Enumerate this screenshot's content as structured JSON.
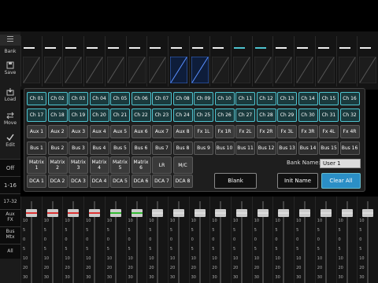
{
  "sidebar": {
    "items": [
      {
        "label": "Bank"
      },
      {
        "label": "Save"
      },
      {
        "label": "Load"
      },
      {
        "label": "Move"
      },
      {
        "label": "Edit"
      },
      {
        "label": "Off"
      },
      {
        "label": "1-16"
      },
      {
        "label": "17-32"
      },
      {
        "label": "Aux\nFX"
      },
      {
        "label": "Bus\nMtx"
      },
      {
        "label": "All"
      }
    ]
  },
  "grid": {
    "channels_row1": [
      "Ch 01",
      "Ch 02",
      "Ch 03",
      "Ch 04",
      "Ch 05",
      "Ch 06",
      "Ch 07",
      "Ch 08",
      "Ch 09",
      "Ch 10",
      "Ch 11",
      "Ch 12",
      "Ch 13",
      "Ch 14",
      "Ch 15",
      "Ch 16"
    ],
    "channels_row2": [
      "Ch 17",
      "Ch 18",
      "Ch 19",
      "Ch 20",
      "Ch 21",
      "Ch 22",
      "Ch 23",
      "Ch 24",
      "Ch 25",
      "Ch 26",
      "Ch 27",
      "Ch 28",
      "Ch 29",
      "Ch 30",
      "Ch 31",
      "Ch 32"
    ],
    "aux_row": [
      "Aux 1",
      "Aux 2",
      "Aux 3",
      "Aux 4",
      "Aux 5",
      "Aux 6",
      "Aux 7",
      "Aux 8",
      "Fx 1L",
      "Fx 1R",
      "Fx 2L",
      "Fx 2R",
      "Fx 3L",
      "Fx 3R",
      "Fx 4L",
      "Fx 4R"
    ],
    "bus_row": [
      "Bus 1",
      "Bus 2",
      "Bus 3",
      "Bus 4",
      "Bus 5",
      "Bus 6",
      "Bus 7",
      "Bus 8",
      "Bus 9",
      "Bus 10",
      "Bus 11",
      "Bus 12",
      "Bus 13",
      "Bus 14",
      "Bus 15",
      "Bus 16"
    ],
    "matrix_row": [
      "Matrix\n1",
      "Matrix\n2",
      "Matrix\n3",
      "Matrix\n4",
      "Matrix\n5",
      "Matrix\n6",
      "LR",
      "M/C"
    ],
    "dca_row": [
      "DCA 1",
      "DCA 2",
      "DCA 3",
      "DCA 4",
      "DCA 5",
      "DCA 6",
      "DCA 7",
      "DCA 8"
    ]
  },
  "actions": {
    "blank": "Blank",
    "init_name": "Init Name",
    "clear_all": "Clear All"
  },
  "bank_name": {
    "label": "Bank Name",
    "value": "User 1"
  },
  "faders": {
    "scale": [
      "10",
      "5",
      "0",
      "5",
      "10",
      "20",
      "30"
    ],
    "stripe_colors": [
      "#d33",
      "#d33",
      "#d33",
      "#d33",
      "#3b3",
      "#3b3",
      "#ddd",
      "#ddd",
      "#ddd",
      "#ddd",
      "#ddd",
      "#ddd",
      "#ddd",
      "#ddd",
      "#ddd",
      "#ddd",
      "#ddd"
    ]
  },
  "colors": {
    "channel_border": "#4ec3cf",
    "clear_all": "#2b8fc6"
  }
}
